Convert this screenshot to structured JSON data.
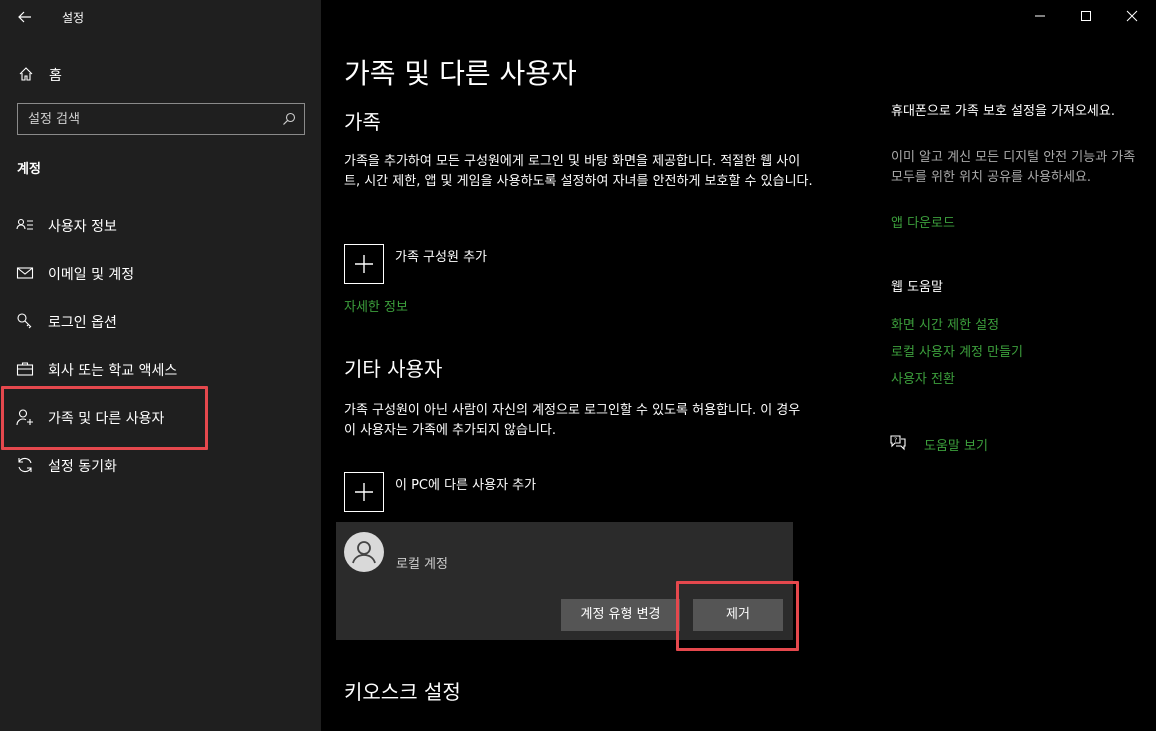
{
  "window": {
    "title": "설정",
    "controls": [
      "minimize-icon",
      "maximize-icon",
      "close-icon"
    ]
  },
  "sidebar": {
    "home_label": "홈",
    "search_placeholder": "설정 검색",
    "section_label": "계정",
    "items": [
      {
        "label": "사용자 정보",
        "icon": "user-info-icon"
      },
      {
        "label": "이메일 및 계정",
        "icon": "mail-icon"
      },
      {
        "label": "로그인 옵션",
        "icon": "key-icon"
      },
      {
        "label": "회사 또는 학교 액세스",
        "icon": "briefcase-icon"
      },
      {
        "label": "가족 및 다른 사용자",
        "icon": "add-person-icon",
        "selected": true
      },
      {
        "label": "설정 동기화",
        "icon": "sync-icon"
      }
    ]
  },
  "main": {
    "title": "가족 및 다른 사용자",
    "family": {
      "heading": "가족",
      "description": "가족을 추가하여 모든 구성원에게 로그인 및 바탕 화면을 제공합니다. 적절한 웹 사이트, 시간 제한, 앱 및 게임을 사용하도록 설정하여 자녀를 안전하게 보호할 수 있습니다.",
      "add_label": "가족 구성원 추가",
      "more_info_link": "자세한 정보"
    },
    "other_users": {
      "heading": "기타 사용자",
      "description": "가족 구성원이 아닌 사람이 자신의 계정으로 로그인할 수 있도록 허용합니다. 이 경우 이 사용자는 가족에 추가되지 않습니다.",
      "add_label": "이 PC에 다른 사용자 추가",
      "account": {
        "name": "로컬 계정",
        "change_type_button": "계정 유형 변경",
        "remove_button": "제거"
      }
    },
    "kiosk": {
      "heading": "키오스크 설정"
    }
  },
  "right_panel": {
    "phone_heading": "휴대폰으로 가족 보호 설정을 가져오세요.",
    "phone_description": "이미 알고 계신 모든 디지털 안전 기능과 가족 모두를 위한 위치 공유를 사용하세요.",
    "app_download_link": "앱 다운로드",
    "web_help_heading": "웹 도움말",
    "web_help_links": [
      "화면 시간 제한 설정",
      "로컬 사용자 계정 만들기",
      "사용자 전환"
    ],
    "help_link": "도움말 보기"
  },
  "colors": {
    "accent_link": "#3c9f3c",
    "highlight": "#e5484d",
    "sidebar_bg": "#1f1f1f",
    "main_bg": "#000000"
  }
}
